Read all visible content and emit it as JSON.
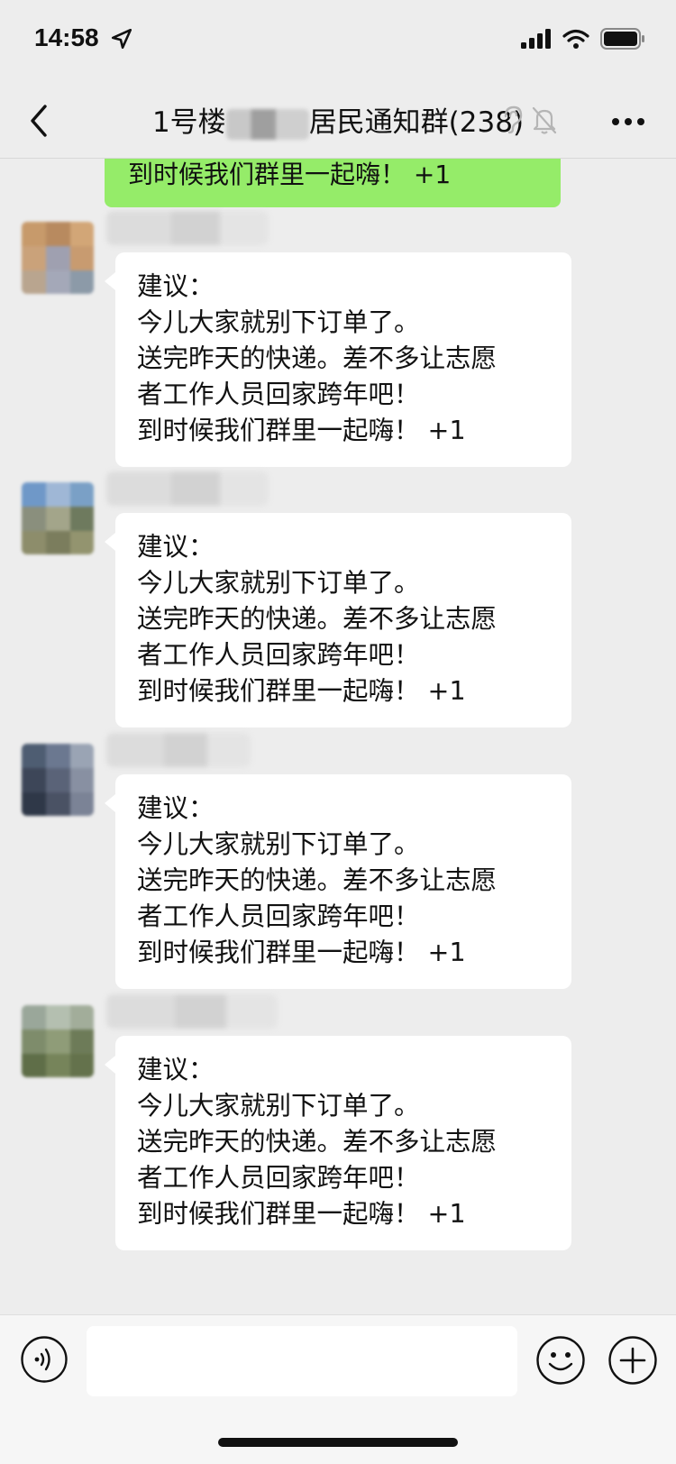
{
  "status_bar": {
    "time": "14:58",
    "icons": [
      "location-arrow-icon",
      "cellular-signal-icon",
      "wifi-icon",
      "battery-icon"
    ]
  },
  "nav": {
    "title_prefix": "1号楼",
    "title_suffix": "居民通知群(238)",
    "icons": [
      "back-chevron-icon",
      "earpiece-icon",
      "mute-bell-icon",
      "more-dots-icon"
    ]
  },
  "own_message": {
    "text": "到时候我们群里一起嗨！ +1",
    "color": "#95ec69"
  },
  "messages": [
    {
      "lines": [
        "建议：",
        "今儿大家就别下订单了。",
        "送完昨天的快递。差不多让志愿",
        "者工作人员回家跨年吧！",
        "到时候我们群里一起嗨！ +1"
      ]
    },
    {
      "lines": [
        "建议：",
        "今儿大家就别下订单了。",
        "送完昨天的快递。差不多让志愿",
        "者工作人员回家跨年吧！",
        "到时候我们群里一起嗨！ +1"
      ]
    },
    {
      "lines": [
        "建议：",
        "今儿大家就别下订单了。",
        "送完昨天的快递。差不多让志愿",
        "者工作人员回家跨年吧！",
        "到时候我们群里一起嗨！ +1"
      ]
    },
    {
      "lines": [
        "建议：",
        "今儿大家就别下订单了。",
        "送完昨天的快递。差不多让志愿",
        "者工作人员回家跨年吧！",
        "到时候我们群里一起嗨！ +1"
      ]
    }
  ],
  "input_bar": {
    "value": "",
    "icons": [
      "voice-input-icon",
      "emoji-icon",
      "plus-icon"
    ]
  },
  "colors": {
    "background": "#ededed",
    "incoming_bubble": "#ffffff",
    "outgoing_bubble": "#95ec69"
  }
}
